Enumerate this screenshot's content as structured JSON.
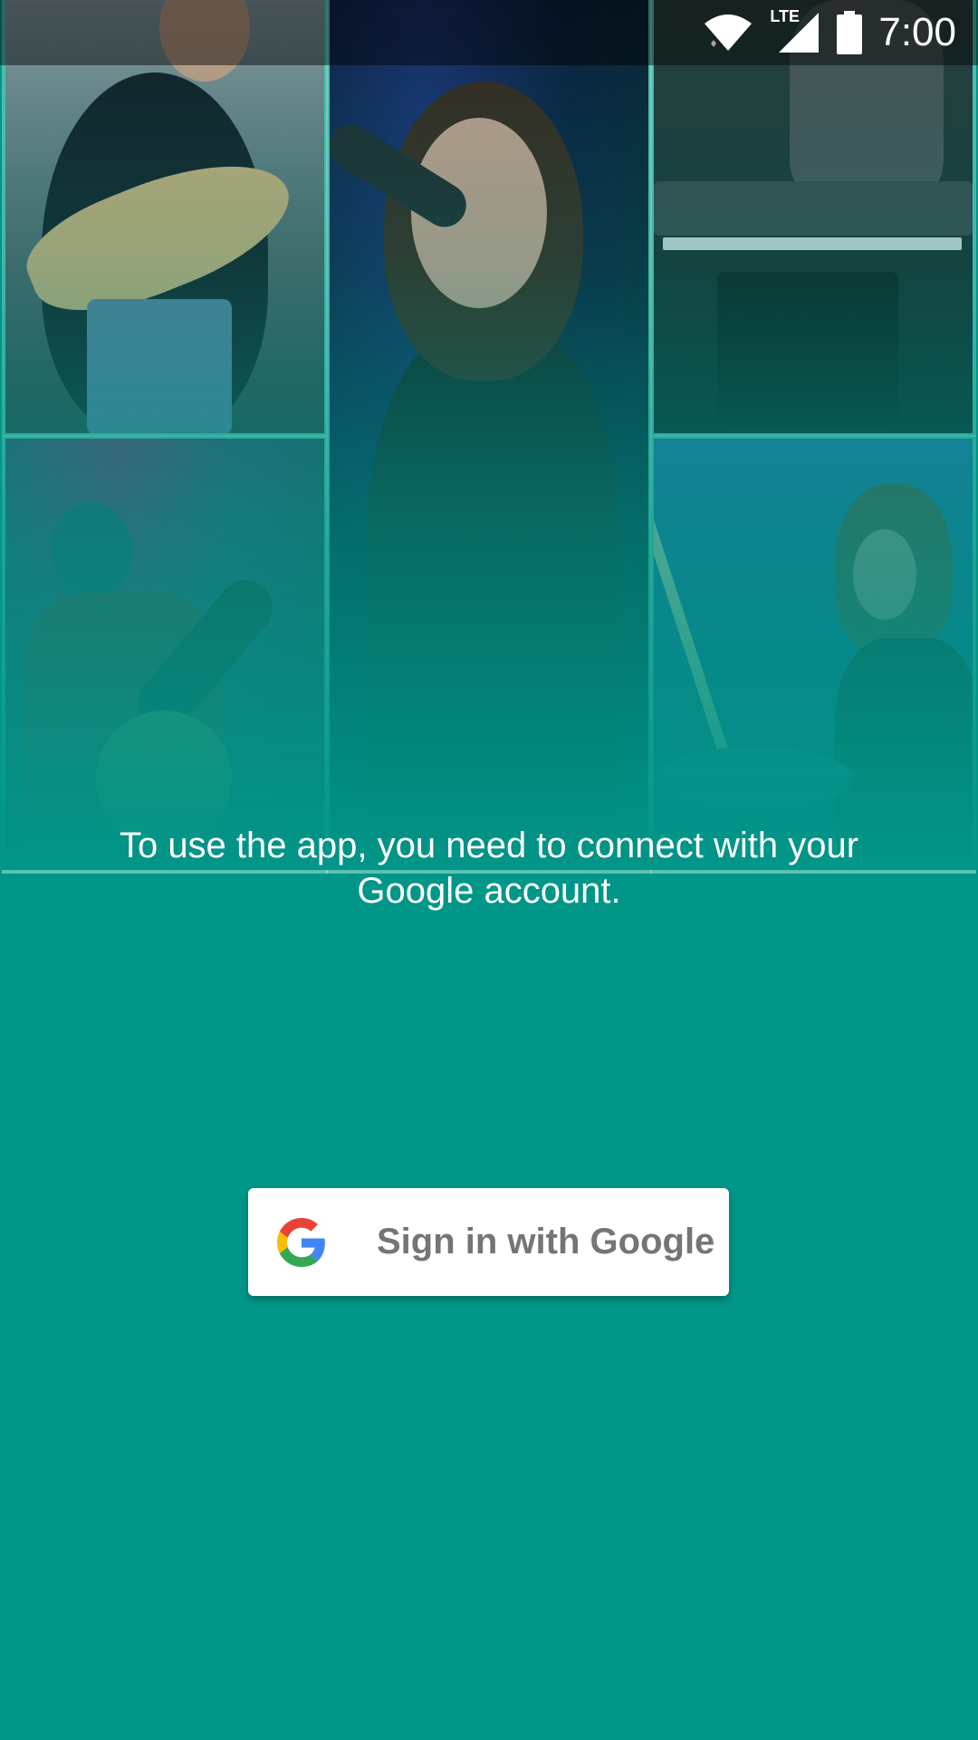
{
  "status_bar": {
    "time": "7:00",
    "network_label": "LTE",
    "icons": [
      "wifi-icon",
      "lte-signal-icon",
      "battery-icon"
    ]
  },
  "background": {
    "photos": [
      "bassist-photo",
      "singer-photo",
      "keyboardist-photo",
      "guitarist-photo",
      "drummer-photo"
    ]
  },
  "message": {
    "text": "To use the app, you need to connect with your Google account."
  },
  "signin": {
    "label": "Sign in with Google",
    "icon": "google-g-icon"
  },
  "colors": {
    "primary": "#009688",
    "button_bg": "#ffffff",
    "button_text": "#757575"
  }
}
